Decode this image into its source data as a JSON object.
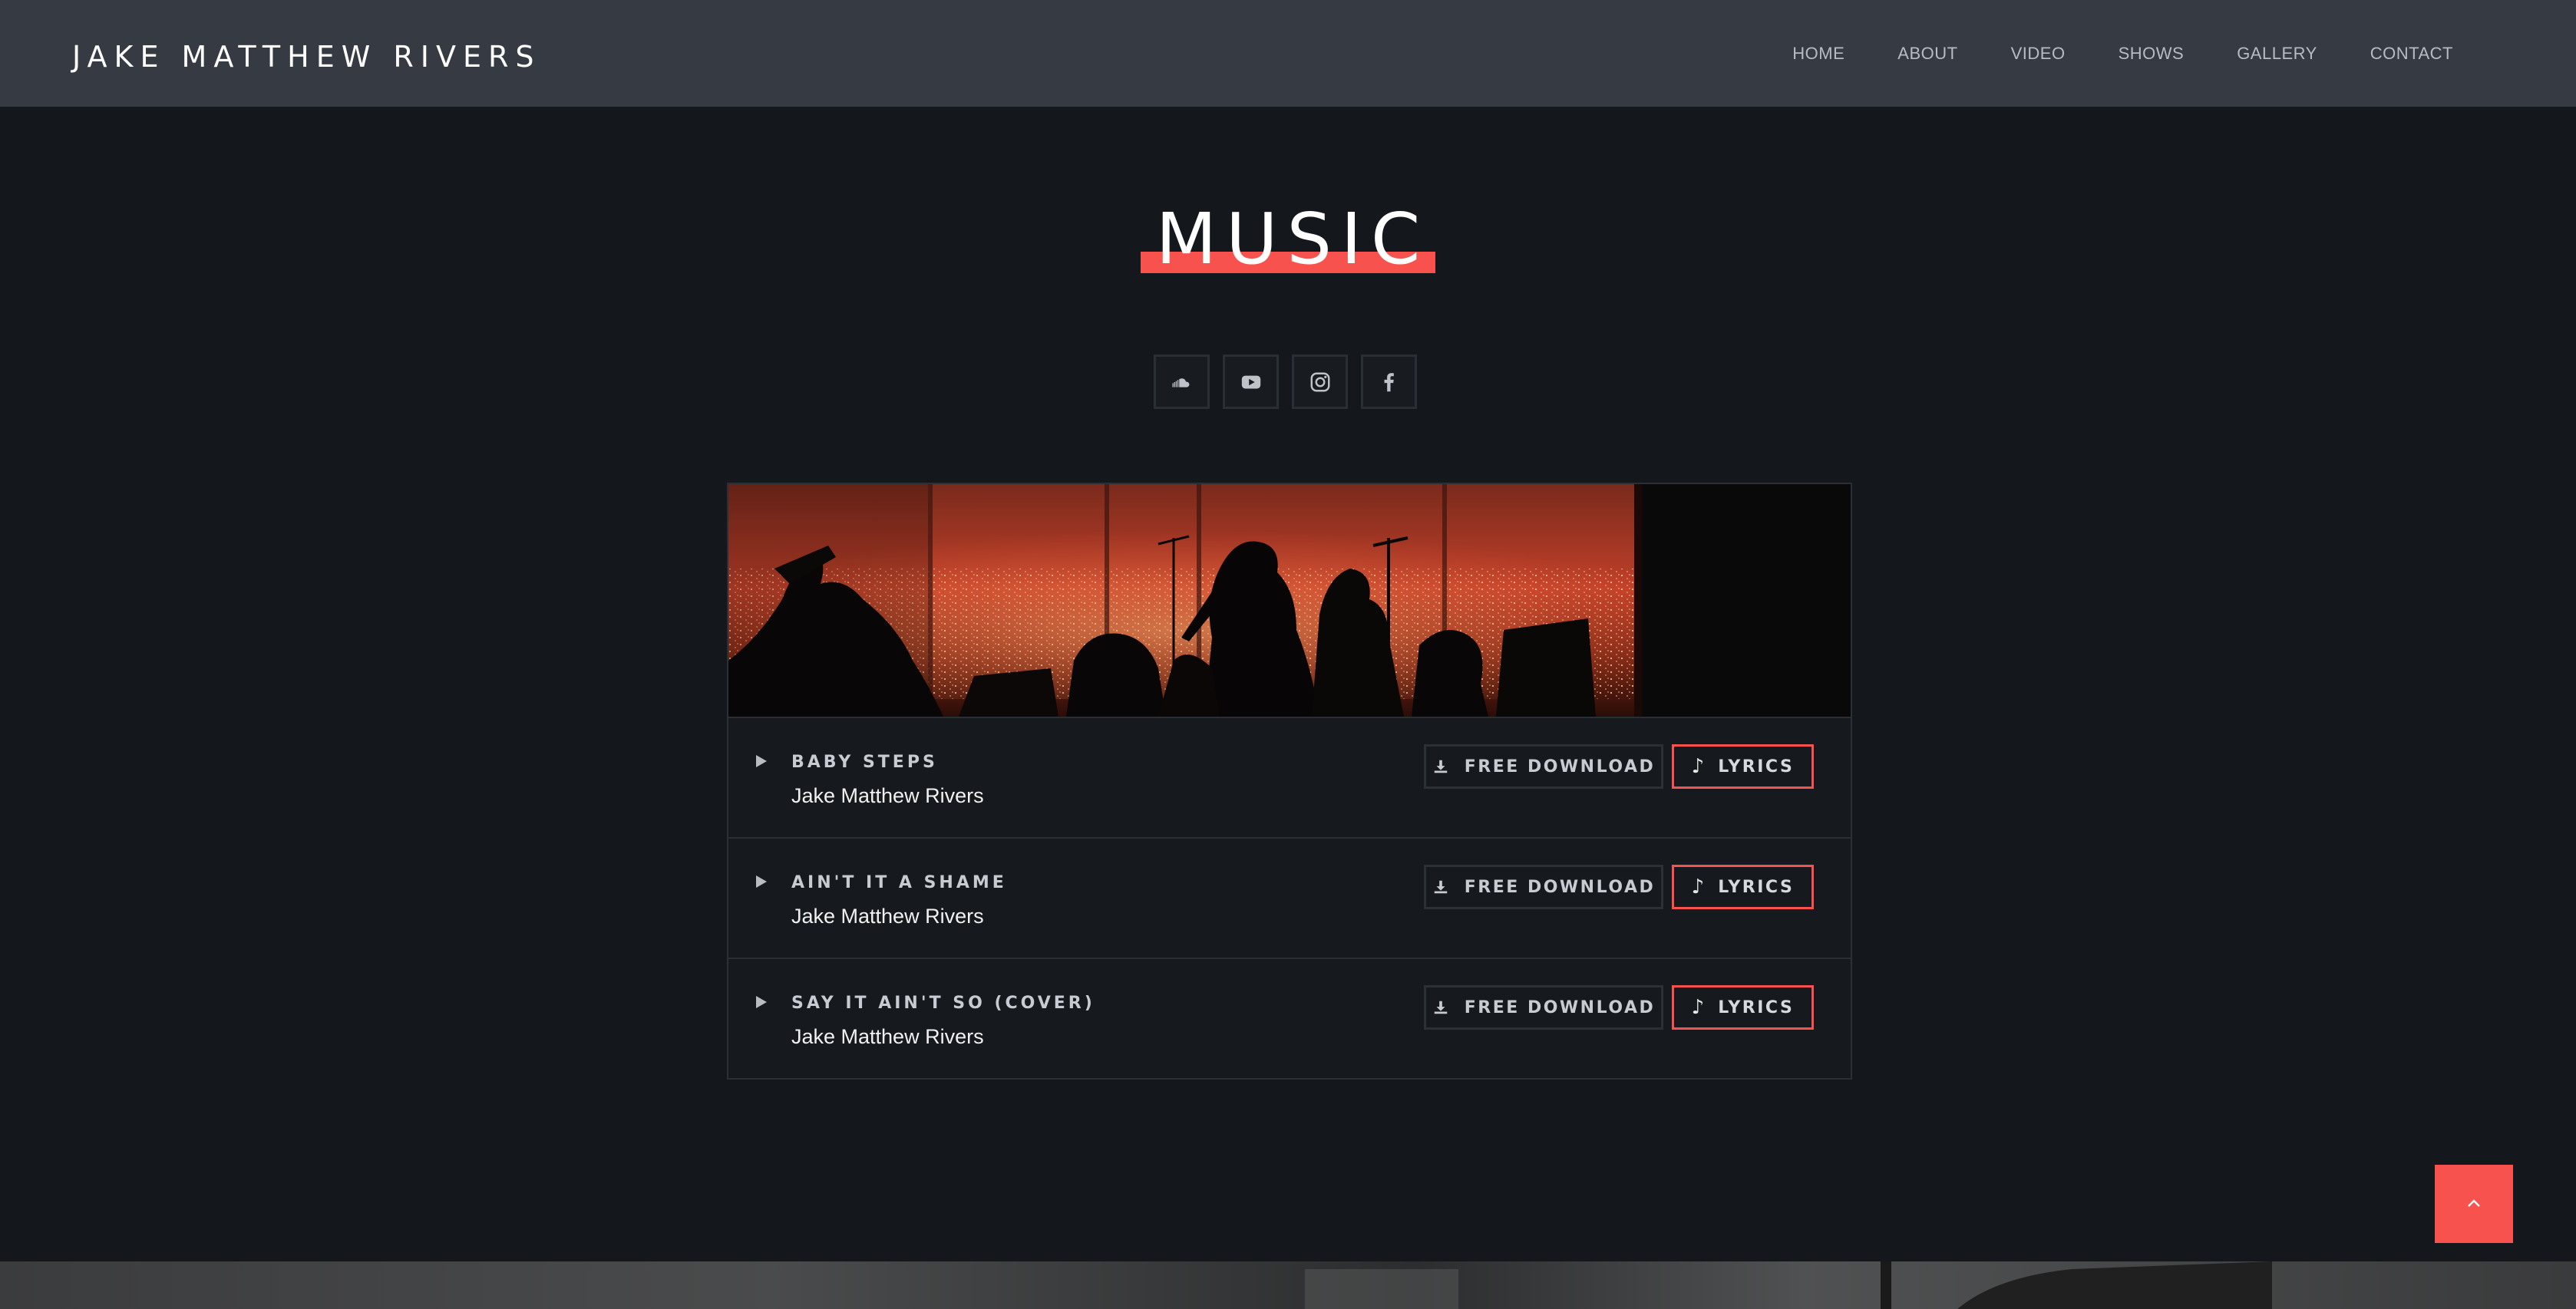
{
  "site": {
    "brand": "JAKE MATTHEW RIVERS",
    "nav": [
      "HOME",
      "ABOUT",
      "VIDEO",
      "SHOWS",
      "GALLERY",
      "CONTACT"
    ]
  },
  "section": {
    "title": "MUSIC",
    "accent_color": "#f7524d"
  },
  "socials": [
    {
      "icon": "soundcloud-icon"
    },
    {
      "icon": "youtube-icon"
    },
    {
      "icon": "instagram-icon"
    },
    {
      "icon": "facebook-icon"
    }
  ],
  "tracks": [
    {
      "title": "BABY STEPS",
      "artist": "Jake Matthew Rivers",
      "download_label": "FREE DOWNLOAD",
      "lyrics_label": "LYRICS"
    },
    {
      "title": "AIN'T IT A SHAME",
      "artist": "Jake Matthew Rivers",
      "download_label": "FREE DOWNLOAD",
      "lyrics_label": "LYRICS"
    },
    {
      "title": "SAY IT AIN'T SO (COVER)",
      "artist": "Jake Matthew Rivers",
      "download_label": "FREE DOWNLOAD",
      "lyrics_label": "LYRICS"
    }
  ],
  "icons": {
    "play": "play-icon",
    "download": "download-icon",
    "lyrics": "music-note-icon",
    "to_top": "chevron-up-icon"
  }
}
